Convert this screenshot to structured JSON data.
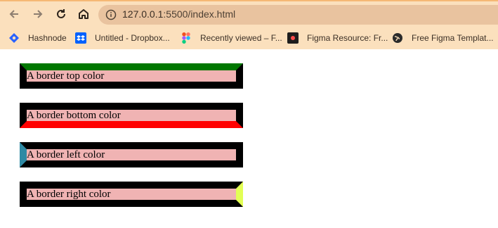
{
  "browser": {
    "url": "127.0.0.1:5500/index.html",
    "url_host": "127.0.0.1",
    "url_path": ":5500/index.html",
    "bookmarks": [
      {
        "label": "Hashnode",
        "icon": "hashnode-icon"
      },
      {
        "label": "Untitled - Dropbox...",
        "icon": "dropbox-icon"
      },
      {
        "label": "Recently viewed – F...",
        "icon": "figma-icon"
      },
      {
        "label": "Figma Resource: Fr...",
        "icon": "figma-resource-icon"
      },
      {
        "label": "Free Figma Templat...",
        "icon": "globe-icon"
      }
    ]
  },
  "page": {
    "items": [
      {
        "text": "A border top color",
        "border_color": "#007700"
      },
      {
        "text": "A border bottom color",
        "border_color": "#ff0000"
      },
      {
        "text": "A border left color",
        "border_color": "#2f8aa4"
      },
      {
        "text": "A border right color",
        "border_color": "#e2ff55"
      }
    ],
    "box_background": "#f0b3b3",
    "border_base_color": "#000000"
  }
}
